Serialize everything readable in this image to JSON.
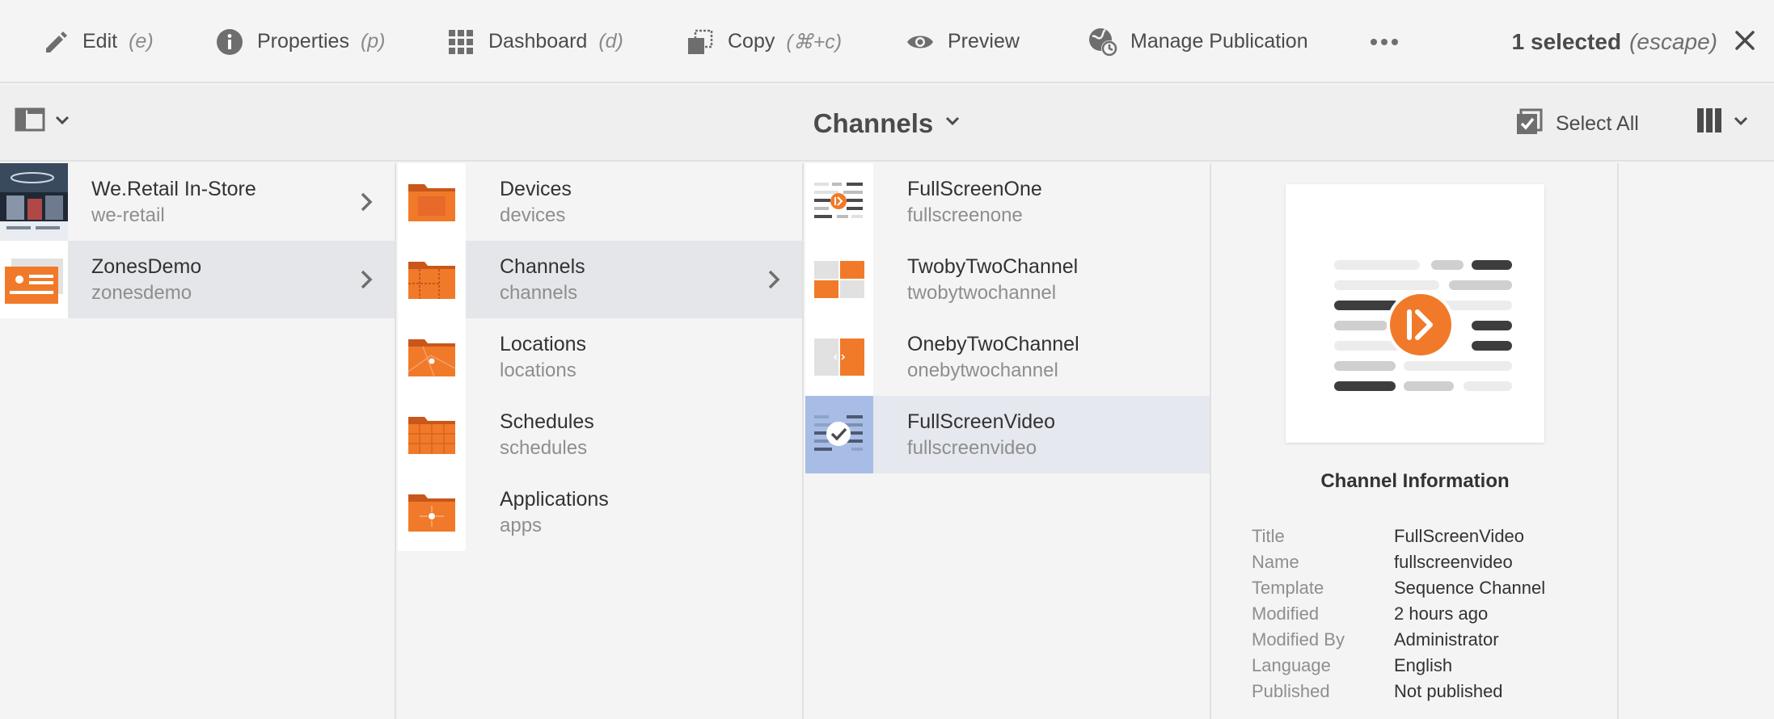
{
  "actionbar": {
    "actions": [
      {
        "label": "Edit",
        "shortcut": "(e)",
        "icon": "pencil-icon"
      },
      {
        "label": "Properties",
        "shortcut": "(p)",
        "icon": "info-icon"
      },
      {
        "label": "Dashboard",
        "shortcut": "(d)",
        "icon": "grid-icon"
      },
      {
        "label": "Copy",
        "shortcut": "(⌘+c)",
        "icon": "copy-icon"
      },
      {
        "label": "Preview",
        "shortcut": "",
        "icon": "eye-icon"
      },
      {
        "label": "Manage Publication",
        "shortcut": "",
        "icon": "globe-clock-icon"
      }
    ],
    "more_icon": "more-icon",
    "selection_count": "1 selected",
    "selection_hint": "(escape)",
    "close_icon": "close-icon"
  },
  "header": {
    "title": "Channels",
    "select_all_label": "Select All",
    "rail_icon": "rail-toggle-icon",
    "view_icon": "column-view-icon"
  },
  "columns": [
    {
      "items": [
        {
          "title": "We.Retail In-Store",
          "name": "we-retail",
          "state": "normal",
          "has_children": true,
          "thumb": "we-retail-thumbnail"
        },
        {
          "title": "ZonesDemo",
          "name": "zonesdemo",
          "state": "active",
          "has_children": true,
          "thumb": "zonesdemo-thumbnail"
        }
      ]
    },
    {
      "items": [
        {
          "title": "Devices",
          "name": "devices",
          "state": "normal",
          "has_children": false,
          "thumb": "folder-devices-icon"
        },
        {
          "title": "Channels",
          "name": "channels",
          "state": "active",
          "has_children": true,
          "thumb": "folder-channels-icon"
        },
        {
          "title": "Locations",
          "name": "locations",
          "state": "normal",
          "has_children": false,
          "thumb": "folder-locations-icon"
        },
        {
          "title": "Schedules",
          "name": "schedules",
          "state": "normal",
          "has_children": false,
          "thumb": "folder-schedules-icon"
        },
        {
          "title": "Applications",
          "name": "apps",
          "state": "normal",
          "has_children": false,
          "thumb": "folder-apps-icon"
        }
      ]
    },
    {
      "items": [
        {
          "title": "FullScreenOne",
          "name": "fullscreenone",
          "state": "normal",
          "has_children": false,
          "thumb": "sequence-channel-thumbnail"
        },
        {
          "title": "TwobyTwoChannel",
          "name": "twobytwochannel",
          "state": "normal",
          "has_children": false,
          "thumb": "two-by-two-thumbnail"
        },
        {
          "title": "OnebyTwoChannel",
          "name": "onebytwochannel",
          "state": "normal",
          "has_children": false,
          "thumb": "one-by-two-thumbnail"
        },
        {
          "title": "FullScreenVideo",
          "name": "fullscreenvideo",
          "state": "selected",
          "has_children": false,
          "thumb": "selected-check-thumbnail"
        }
      ]
    }
  ],
  "details": {
    "title": "Channel Information",
    "preview_icon": "sequence-channel-preview",
    "fields": [
      {
        "key": "Title",
        "value": "FullScreenVideo"
      },
      {
        "key": "Name",
        "value": "fullscreenvideo"
      },
      {
        "key": "Template",
        "value": "Sequence Channel"
      },
      {
        "key": "Modified",
        "value": "2 hours ago"
      },
      {
        "key": "Modified By",
        "value": "Administrator"
      },
      {
        "key": "Language",
        "value": "English"
      },
      {
        "key": "Published",
        "value": "Not published"
      }
    ]
  },
  "colors": {
    "accent_orange": "#f07a29",
    "selection_blue": "#a8bde6",
    "active_row": "#e4e6ea",
    "icon_gray": "#6e6e6e"
  }
}
